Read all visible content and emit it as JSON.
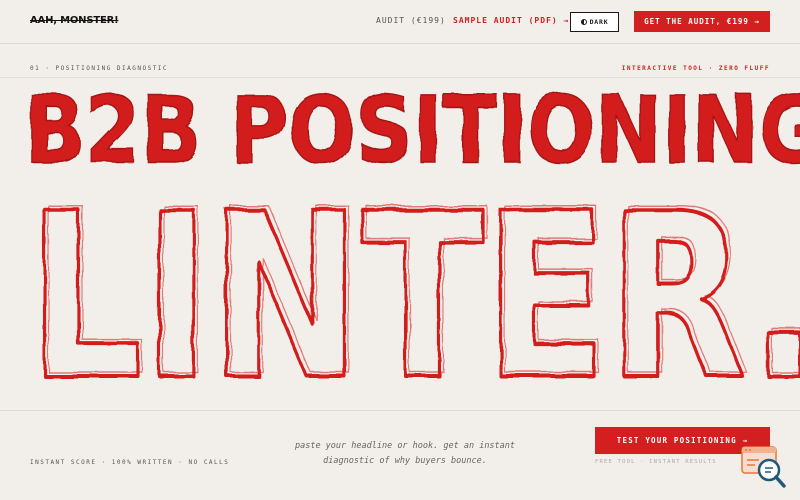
{
  "nav": {
    "logo": "AAH, MONSTER!",
    "audit_link": "AUDIT (€199)",
    "sample_link": "SAMPLE AUDIT (PDF) →",
    "dark_toggle": "DARK",
    "cta": "GET THE AUDIT, €199 →"
  },
  "subheader": {
    "left": "01 · POSITIONING DIAGNOSTIC",
    "right": "INTERACTIVE TOOL · ZERO FLUFF"
  },
  "hero": {
    "line1": "B2B POSITIONING",
    "line2": "LINTER."
  },
  "bottom": {
    "left": "INSTANT SCORE · 100% WRITTEN · NO CALLS",
    "tagline_line1": "paste your headline or hook. get an instant",
    "tagline_line2": "diagnostic of why buyers bounce.",
    "cta": "TEST YOUR POSITIONING →",
    "cta_note": "FREE TOOL · INSTANT RESULTS"
  },
  "colors": {
    "accent": "#d31f1f",
    "background": "#f2efea"
  },
  "icons": {
    "dark_toggle": "half-moon-icon",
    "widget": "search-chat-widget-icon"
  }
}
